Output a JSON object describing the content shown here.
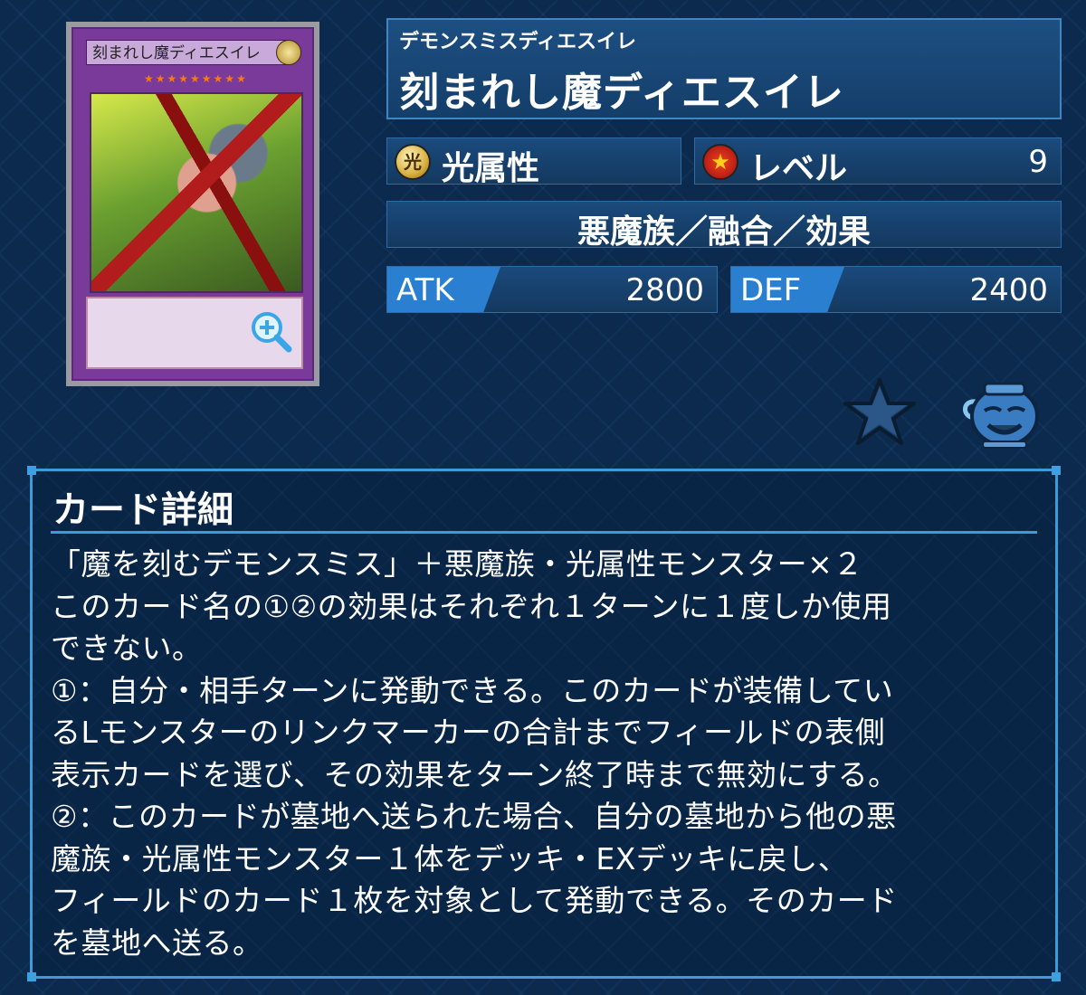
{
  "card_image": {
    "name_text": "刻まれし魔ディエスイレ",
    "stars": "★★★★★★★★★"
  },
  "header": {
    "ruby": "デモンスミスディエスイレ",
    "name": "刻まれし魔ディエスイレ"
  },
  "attribute": {
    "glyph": "光",
    "label": "光属性"
  },
  "level": {
    "label": "レベル",
    "value": "9"
  },
  "type_line": "悪魔族／融合／効果",
  "stats": {
    "atk_label": "ATK",
    "atk_value": "2800",
    "def_label": "DEF",
    "def_value": "2400"
  },
  "icons": {
    "favorite": "star-icon",
    "pot": "pot-of-greed-icon",
    "zoom": "zoom-in-icon"
  },
  "details": {
    "title": "カード詳細",
    "text": "「魔を刻むデモンスミス」＋悪魔族・光属性モンスター×２\nこのカード名の①②の効果はそれぞれ１ターンに１度しか使用\nできない。\n①：自分・相手ターンに発動できる。このカードが装備してい\nるLモンスターのリンクマーカーの合計までフィールドの表側\n表示カードを選び、その効果をターン終了時まで無効にする。\n②：このカードが墓地へ送られた場合、自分の墓地から他の悪\n魔族・光属性モンスター１体をデッキ・EXデッキに戻し、\nフィールドのカード１枚を対象として発動できる。そのカード\nを墓地へ送る。"
  },
  "colors": {
    "accent": "#3f9ad8",
    "stat_tab": "#2a7fd0",
    "background": "#0b2a4d"
  }
}
